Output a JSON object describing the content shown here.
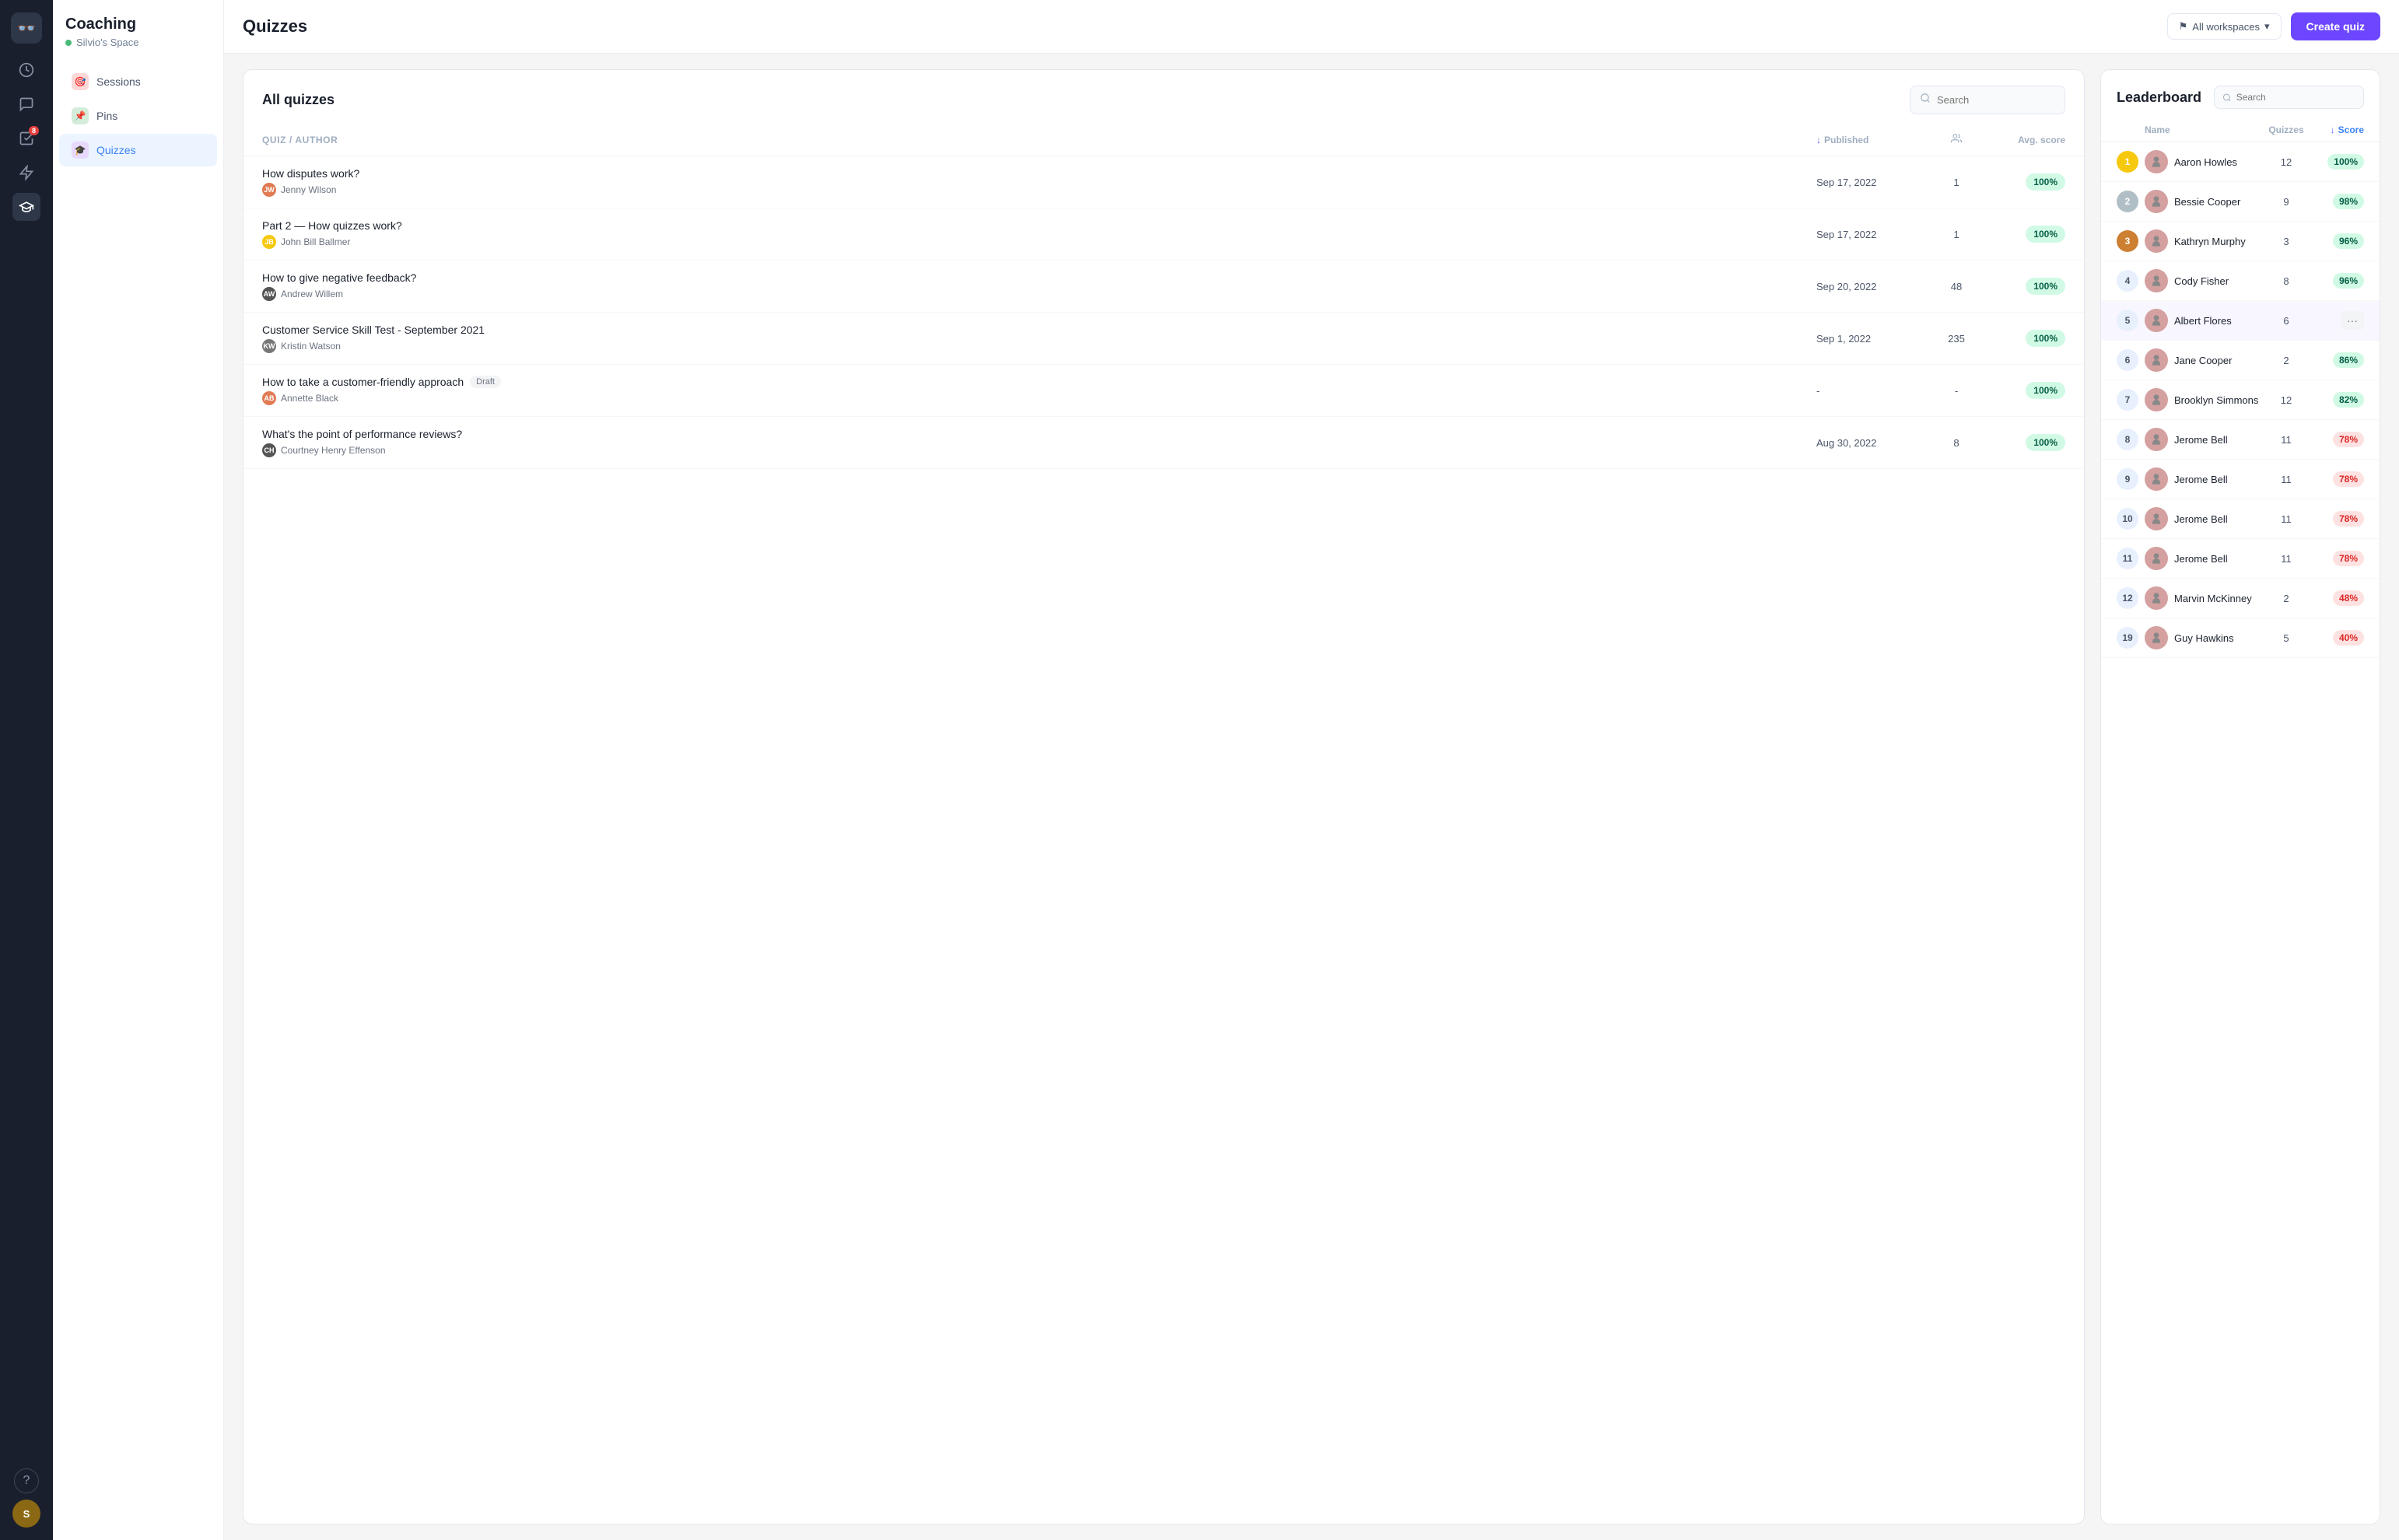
{
  "app": {
    "logo_text": "👓",
    "title": "Coaching",
    "space": "Silvio's Space"
  },
  "nav": {
    "items": [
      {
        "id": "sessions",
        "label": "Sessions",
        "icon": "🎯",
        "icon_class": "sessions",
        "active": false
      },
      {
        "id": "pins",
        "label": "Pins",
        "icon": "📌",
        "icon_class": "pins",
        "active": false
      },
      {
        "id": "quizzes",
        "label": "Quizzes",
        "icon": "🎓",
        "icon_class": "quizzes",
        "active": true
      }
    ]
  },
  "sidebar_icons": [
    {
      "id": "clock",
      "symbol": "🕐",
      "active": false
    },
    {
      "id": "chat",
      "symbol": "💬",
      "active": false
    },
    {
      "id": "tasks",
      "symbol": "✓",
      "active": false,
      "badge": "8"
    },
    {
      "id": "lightning",
      "symbol": "⚡",
      "active": false
    },
    {
      "id": "graduation",
      "symbol": "🎓",
      "active": true
    }
  ],
  "topbar": {
    "page_title": "Quizzes",
    "workspace_label": "All workspaces",
    "create_quiz_label": "Create quiz"
  },
  "quizzes_panel": {
    "title": "All quizzes",
    "search_placeholder": "Search",
    "columns": {
      "quiz_author": "Quiz / Author",
      "published": "Published",
      "participants": "👥",
      "avg_score": "Avg. score"
    },
    "rows": [
      {
        "title": "How disputes work?",
        "author": "Jenny Wilson",
        "author_color": "#e07b54",
        "author_initials": "JW",
        "published": "Sep 17, 2022",
        "participants": "1",
        "score": "100%",
        "score_type": "green",
        "draft": false,
        "dash_published": false
      },
      {
        "title": "Part 2 — How quizzes work?",
        "author": "John Bill Ballmer",
        "author_color": "#f6c90e",
        "author_initials": "JB",
        "published": "Sep 17, 2022",
        "participants": "1",
        "score": "100%",
        "score_type": "green",
        "draft": false,
        "dash_published": false
      },
      {
        "title": "How to give negative feedback?",
        "author": "Andrew Willem",
        "author_color": "#555",
        "author_initials": "AW",
        "published": "Sep 20, 2022",
        "participants": "48",
        "score": "100%",
        "score_type": "green",
        "draft": false,
        "dash_published": false
      },
      {
        "title": "Customer Service Skill Test - September 2021",
        "author": "Kristin Watson",
        "author_color": "#777",
        "author_initials": "KW",
        "published": "Sep 1, 2022",
        "participants": "235",
        "score": "100%",
        "score_type": "green",
        "draft": false,
        "dash_published": false
      },
      {
        "title": "How to take a customer-friendly approach",
        "author": "Annette Black",
        "author_color": "#e07b54",
        "author_initials": "AB",
        "published": "-",
        "participants": "-",
        "score": "100%",
        "score_type": "green",
        "draft": true,
        "dash_published": true
      },
      {
        "title": "What's the point of performance reviews?",
        "author": "Courtney Henry Effenson",
        "author_color": "#555",
        "author_initials": "CH",
        "published": "Aug 30, 2022",
        "participants": "8",
        "score": "100%",
        "score_type": "green",
        "draft": false,
        "dash_published": false
      }
    ]
  },
  "leaderboard": {
    "title": "Leaderboard",
    "search_placeholder": "Search",
    "columns": {
      "name": "Name",
      "quizzes": "Quizzes",
      "score": "Score"
    },
    "rows": [
      {
        "rank": 1,
        "rank_type": "gold",
        "name": "Aaron Howles",
        "quizzes": 12,
        "score": "100%",
        "score_type": "green",
        "active": false
      },
      {
        "rank": 2,
        "rank_type": "silver",
        "name": "Bessie Cooper",
        "quizzes": 9,
        "score": "98%",
        "score_type": "green",
        "active": false
      },
      {
        "rank": 3,
        "rank_type": "bronze",
        "name": "Kathryn Murphy",
        "quizzes": 3,
        "score": "96%",
        "score_type": "green",
        "active": false
      },
      {
        "rank": 4,
        "rank_type": "num",
        "name": "Cody Fisher",
        "quizzes": 8,
        "score": "96%",
        "score_type": "green",
        "active": false
      },
      {
        "rank": 5,
        "rank_type": "num",
        "name": "Albert Flores",
        "quizzes": 6,
        "score": "...",
        "score_type": "dots",
        "active": true
      },
      {
        "rank": 6,
        "rank_type": "num",
        "name": "Jane Cooper",
        "quizzes": 2,
        "score": "86%",
        "score_type": "green",
        "active": false
      },
      {
        "rank": 7,
        "rank_type": "num",
        "name": "Brooklyn Simmons",
        "quizzes": 12,
        "score": "82%",
        "score_type": "green",
        "active": false
      },
      {
        "rank": 8,
        "rank_type": "num",
        "name": "Jerome Bell",
        "quizzes": 11,
        "score": "78%",
        "score_type": "red",
        "active": false
      },
      {
        "rank": 9,
        "rank_type": "num",
        "name": "Jerome Bell",
        "quizzes": 11,
        "score": "78%",
        "score_type": "red",
        "active": false
      },
      {
        "rank": 10,
        "rank_type": "num",
        "name": "Jerome Bell",
        "quizzes": 11,
        "score": "78%",
        "score_type": "red",
        "active": false
      },
      {
        "rank": 11,
        "rank_type": "num",
        "name": "Jerome Bell",
        "quizzes": 11,
        "score": "78%",
        "score_type": "red",
        "active": false
      },
      {
        "rank": 12,
        "rank_type": "num",
        "name": "Marvin McKinney",
        "quizzes": 2,
        "score": "48%",
        "score_type": "red",
        "active": false
      },
      {
        "rank": 19,
        "rank_type": "num",
        "name": "Guy Hawkins",
        "quizzes": 5,
        "score": "40%",
        "score_type": "red",
        "active": false
      }
    ]
  },
  "draft_label": "Draft",
  "help_icon": "?",
  "chevron_down": "▾",
  "flag_unicode": "⚑",
  "search_unicode": "🔍"
}
